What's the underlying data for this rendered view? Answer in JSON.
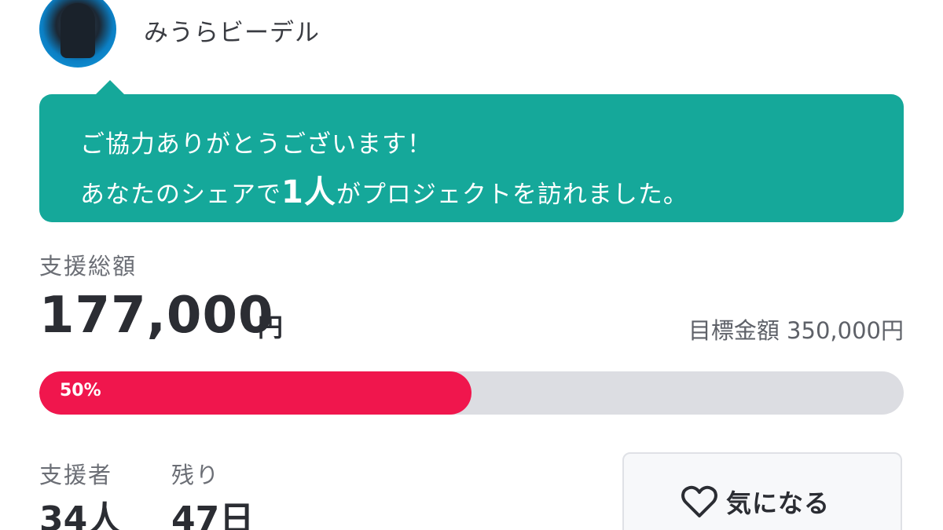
{
  "author": {
    "name": "みうらビーデル"
  },
  "thanks": {
    "line1": "ご協力ありがとうございます！",
    "line2_prefix": "あなたのシェアで",
    "line2_count": "1人",
    "line2_suffix": "がプロジェクトを訪れました。"
  },
  "funding": {
    "total_label": "支援総額",
    "total_amount": "177,000",
    "total_unit": "円",
    "goal_text": "目標金額 350,000円",
    "progress_label": "50%",
    "progress_fraction": 0.5
  },
  "stats": {
    "supporters_label": "支援者",
    "supporters_value": "34人",
    "remaining_label": "残り",
    "remaining_value": "47日"
  },
  "watch_button": {
    "label": "気になる",
    "icon": "heart-outline-icon"
  },
  "colors": {
    "balloon": "#15a89a",
    "progress": "#f0164d",
    "track": "#dcdde2"
  }
}
